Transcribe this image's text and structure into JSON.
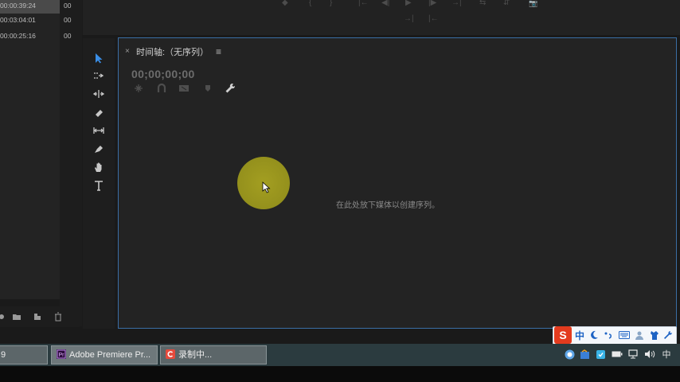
{
  "project_panel": {
    "rows": [
      {
        "duration": "00:00:39:24",
        "extra": "00"
      },
      {
        "duration": "00:03:04:01",
        "extra": "00"
      },
      {
        "duration": "00:00:25:16",
        "extra": "00"
      }
    ]
  },
  "timeline": {
    "close": "×",
    "title": "时间轴:（无序列）",
    "menu": "≡",
    "timecode": "00;00;00;00",
    "drop_hint": "在此处放下媒体以创建序列。"
  },
  "monitor_controls": [
    "◆",
    "{",
    "}",
    "|←",
    "◀|",
    "▶",
    "|▶",
    "→|",
    "⇆",
    "⇵",
    "📷",
    "→|",
    "|←"
  ],
  "ime": {
    "logo": "S",
    "lang": "中",
    "items": [
      "moon-icon",
      "punct-icon",
      "keyboard-icon",
      "user-icon",
      "skin-icon",
      "tools-icon"
    ]
  },
  "taskbar": {
    "buttons": [
      {
        "label": "Adobe Premiere Pr...",
        "icon": "premiere-icon"
      },
      {
        "label": "录制中...",
        "icon": "recorder-icon"
      }
    ],
    "left_fragment": "9",
    "tray_lang": "中"
  },
  "colors": {
    "panel_bg": "#232323",
    "timeline_border": "#3a6ea5",
    "selection_tool": "#3a8ee6",
    "cursor_highlight": "#a8a321",
    "taskbar": "#2b3b3f"
  }
}
